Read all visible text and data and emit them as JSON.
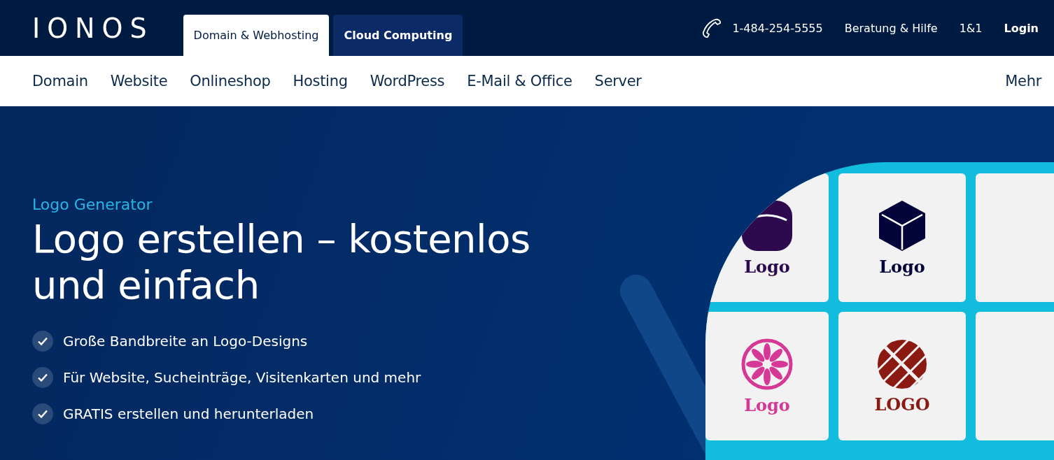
{
  "brand": {
    "logo": "IONOS"
  },
  "top_tabs": [
    {
      "label": "Domain & Webhosting",
      "selected": true
    },
    {
      "label": "Cloud Computing",
      "selected": false
    }
  ],
  "top_links": {
    "phone": "1-484-254-5555",
    "links": [
      "Beratung & Hilfe",
      "1&1"
    ],
    "login": "Login"
  },
  "nav": {
    "items": [
      "Domain",
      "Website",
      "Onlineshop",
      "Hosting",
      "WordPress",
      "E-Mail & Office",
      "Server"
    ],
    "more": "Mehr"
  },
  "hero": {
    "eyebrow": "Logo Generator",
    "title": "Logo erstellen – kostenlos und einfach",
    "features": [
      "Große Bandbreite an Logo-Designs",
      "Für Website, Sucheinträge, Visitenkarten und mehr",
      "GRATIS erstellen und herunterladen"
    ],
    "logo_tiles": [
      {
        "kind": "rounded",
        "label": "Logo",
        "color": "#2d0a4e"
      },
      {
        "kind": "cube",
        "label": "Logo",
        "color": "#03053a"
      },
      {
        "kind": "flower",
        "label": "Logo",
        "color": "#d63895"
      },
      {
        "kind": "weave",
        "label": "LOGO",
        "color": "#8b1a12"
      }
    ]
  }
}
